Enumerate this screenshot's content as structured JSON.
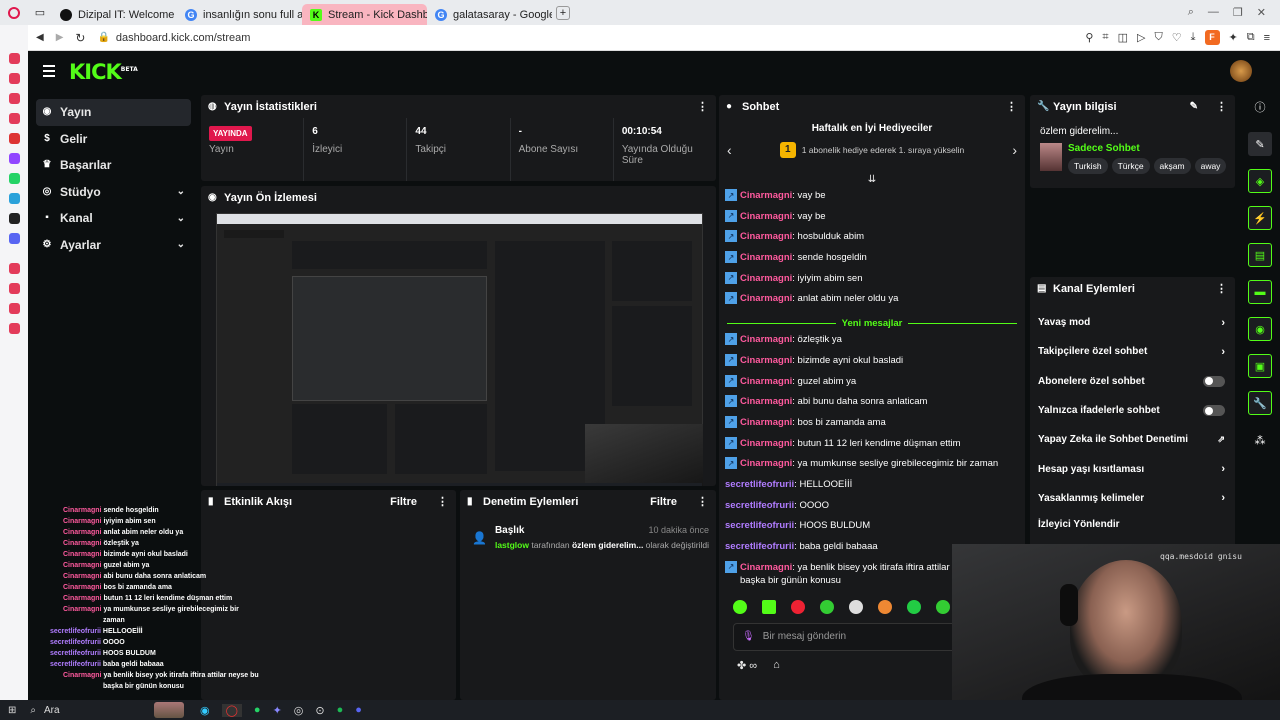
{
  "browser": {
    "tabs": [
      {
        "label": "Dizipal IT: Welcome to De",
        "active": false
      },
      {
        "label": "insanlığın sonu full altyaz",
        "active": false
      },
      {
        "label": "Stream - Kick Dashboard",
        "active": true
      },
      {
        "label": "galatasaray - Google'da A",
        "active": false
      }
    ],
    "url": "dashboard.kick.com/stream",
    "ext_badge": "F"
  },
  "nav": {
    "logo": "KICK",
    "logo_sup": "BETA",
    "items": [
      {
        "label": "Yayın",
        "icon": "broadcast-icon",
        "selected": true
      },
      {
        "label": "Gelir",
        "icon": "dollar-icon"
      },
      {
        "label": "Başarılar",
        "icon": "trophy-icon"
      },
      {
        "label": "Stüdyo",
        "icon": "studio-icon",
        "chevron": true
      },
      {
        "label": "Kanal",
        "icon": "channel-icon",
        "chevron": true
      },
      {
        "label": "Ayarlar",
        "icon": "gear-icon",
        "chevron": true
      }
    ]
  },
  "stats_panel": {
    "title": "Yayın İstatistikleri",
    "live_badge": "YAYINDA",
    "items": [
      {
        "value": "",
        "label": "Yayın"
      },
      {
        "value": "6",
        "label": "İzleyici"
      },
      {
        "value": "44",
        "label": "Takipçi"
      },
      {
        "value": "-",
        "label": "Abone Sayısı"
      },
      {
        "value": "00:10:54",
        "label": "Yayında Olduğu Süre"
      }
    ]
  },
  "preview_panel": {
    "title": "Yayın Ön İzlemesi"
  },
  "activity_panel": {
    "title": "Etkinlik Akışı",
    "filter": "Filtre"
  },
  "moderation_panel": {
    "title": "Denetim Eylemleri",
    "filter": "Filtre",
    "entry": {
      "title": "Başlık",
      "time": "10 dakika önce",
      "user": "lastglow",
      "mid": " tarafından ",
      "what": "özlem giderelim...",
      "tail": " olarak değiştirildi"
    }
  },
  "chat_panel": {
    "title": "Sohbet",
    "gifters_title": "Haftalık en İyi Hediyeciler",
    "gifters_rank": "1",
    "gifters_text": "1 abonelik hediye ederek 1. sıraya yükselin",
    "new_messages": "Yeni mesajlar",
    "messages_before": [
      {
        "user": "Cinarmagni",
        "text": "vay be",
        "badge": true
      },
      {
        "user": "Cinarmagni",
        "text": "vay be",
        "badge": true
      },
      {
        "user": "Cinarmagni",
        "text": "hosbulduk abim",
        "badge": true
      },
      {
        "user": "Cinarmagni",
        "text": "sende hosgeldin",
        "badge": true
      },
      {
        "user": "Cinarmagni",
        "text": "iyiyim abim sen",
        "badge": true
      },
      {
        "user": "Cinarmagni",
        "text": "anlat abim neler oldu ya",
        "badge": true
      }
    ],
    "messages_after": [
      {
        "user": "Cinarmagni",
        "text": "özleştik ya",
        "badge": true
      },
      {
        "user": "Cinarmagni",
        "text": "bizimde ayni okul basladi",
        "badge": true
      },
      {
        "user": "Cinarmagni",
        "text": "guzel abim ya",
        "badge": true
      },
      {
        "user": "Cinarmagni",
        "text": "abi bunu daha sonra anlaticam",
        "badge": true
      },
      {
        "user": "Cinarmagni",
        "text": "bos bi zamanda ama",
        "badge": true
      },
      {
        "user": "Cinarmagni",
        "text": "butun 11 12 leri kendime düşman ettim",
        "badge": true
      },
      {
        "user": "Cinarmagni",
        "text": "ya mumkunse sesliye girebilecegimiz bir zaman",
        "badge": true
      },
      {
        "user": "secretlifeofrurii",
        "text": "HELLOOEİİİ",
        "badge": false
      },
      {
        "user": "secretlifeofrurii",
        "text": "OOOO",
        "badge": false
      },
      {
        "user": "secretlifeofrurii",
        "text": "HOOS BULDUM",
        "badge": false
      },
      {
        "user": "secretlifeofrurii",
        "text": "baba geldi babaaa",
        "badge": false
      },
      {
        "user": "Cinarmagni",
        "text": "ya benlik bisey yok itirafa iftira attilar",
        "text2": "başka bir günün konusu",
        "badge": true
      }
    ],
    "input_placeholder": "Bir mesaj gönderin"
  },
  "stream_info": {
    "title": "Yayın bilgisi",
    "stream_title": "özlem giderelim...",
    "category": "Sadece Sohbet",
    "tags": [
      "Turkish",
      "Türkçe",
      "akşam",
      "away"
    ]
  },
  "channel_actions": {
    "title": "Kanal Eylemleri",
    "rows": [
      {
        "label": "Yavaş mod",
        "type": "arrow"
      },
      {
        "label": "Takipçilere özel sohbet",
        "type": "arrow"
      },
      {
        "label": "Abonelere özel sohbet",
        "type": "toggle"
      },
      {
        "label": "Yalnızca ifadelerle sohbet",
        "type": "toggle"
      },
      {
        "label": "Yapay Zeka ile Sohbet Denetimi",
        "type": "external"
      },
      {
        "label": "Hesap yaşı kısıtlaması",
        "type": "arrow"
      },
      {
        "label": "Yasaklanmış kelimeler",
        "type": "arrow"
      },
      {
        "label": "İzleyici Yönlendir",
        "type": "none"
      }
    ]
  },
  "overlay_chat": [
    {
      "user": "Cinarmagni",
      "text": "sende hosgeldin"
    },
    {
      "user": "Cinarmagni",
      "text": "iyiyim abim sen"
    },
    {
      "user": "Cinarmagni",
      "text": "anlat abim neler oldu ya"
    },
    {
      "user": "Cinarmagni",
      "text": "özleştik ya"
    },
    {
      "user": "Cinarmagni",
      "text": "bizimde ayni okul basladi"
    },
    {
      "user": "Cinarmagni",
      "text": "guzel abim ya"
    },
    {
      "user": "Cinarmagni",
      "text": "abi bunu daha sonra anlaticam"
    },
    {
      "user": "Cinarmagni",
      "text": "bos bi zamanda ama"
    },
    {
      "user": "Cinarmagni",
      "text": "butun 11 12 leri kendime düşman ettim"
    },
    {
      "user": "Cinarmagni",
      "text": "ya mumkunse sesliye girebilecegimiz bir"
    },
    {
      "user": "",
      "text": "zaman"
    },
    {
      "user": "secretlifeofrurii",
      "text": "HELLOOEİİİ"
    },
    {
      "user": "secretlifeofrurii",
      "text": "OOOO"
    },
    {
      "user": "secretlifeofrurii",
      "text": "HOOS BULDUM"
    },
    {
      "user": "secretlifeofrurii",
      "text": "baba geldi babaaa"
    },
    {
      "user": "Cinarmagni",
      "text": "ya benlik bisey yok itirafa iftira attilar neyse bu"
    },
    {
      "user": "",
      "text": "başka bir günün konusu"
    }
  ],
  "webcam_caption": "qqa.mesdoid gnisu",
  "taskbar": {
    "search": "Ara"
  },
  "colors": {
    "kick_green": "#53fc18",
    "live_red": "#e0184d",
    "username_pink": "#ff5a9e",
    "username_purple": "#b07cff"
  }
}
